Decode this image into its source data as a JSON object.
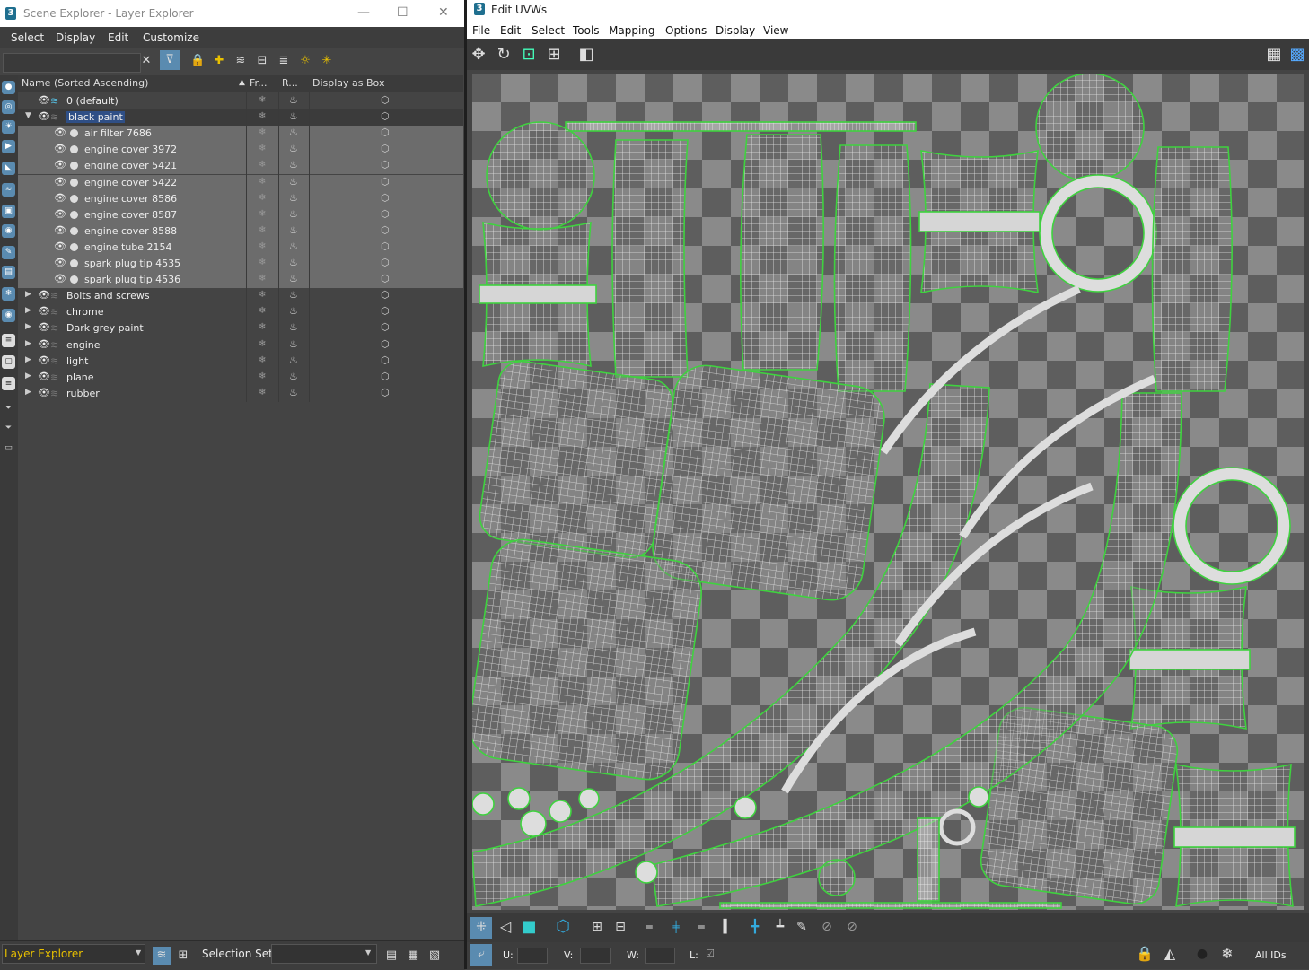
{
  "scene_explorer": {
    "title": "Scene Explorer - Layer Explorer",
    "app_icon": "3",
    "window_controls": [
      "—",
      "☐",
      "✕"
    ],
    "menu": [
      "Select",
      "Display",
      "Edit",
      "Customize"
    ],
    "search_placeholder": "",
    "columns": [
      "Name (Sorted Ascending)",
      "Fr...",
      "R...",
      "Display as Box"
    ],
    "rows": [
      {
        "name": "0 (default)",
        "level": 0,
        "kind": "layer-active",
        "expanded": null,
        "selected": false
      },
      {
        "name": "black paint",
        "level": 0,
        "kind": "layer",
        "expanded": true,
        "selected": true
      },
      {
        "name": "air filter 7686",
        "level": 1,
        "kind": "object",
        "selected": false
      },
      {
        "name": "engine cover 3972",
        "level": 1,
        "kind": "object",
        "selected": false
      },
      {
        "name": "engine cover 5421",
        "level": 1,
        "kind": "object",
        "selected": false
      },
      {
        "name": "engine cover 5422",
        "level": 1,
        "kind": "object",
        "selected": false
      },
      {
        "name": "engine cover 8586",
        "level": 1,
        "kind": "object",
        "selected": false
      },
      {
        "name": "engine cover 8587",
        "level": 1,
        "kind": "object",
        "selected": false
      },
      {
        "name": "engine cover 8588",
        "level": 1,
        "kind": "object",
        "selected": false
      },
      {
        "name": "engine tube 2154",
        "level": 1,
        "kind": "object",
        "selected": false
      },
      {
        "name": "spark plug tip 4535",
        "level": 1,
        "kind": "object",
        "selected": false
      },
      {
        "name": "spark plug tip 4536",
        "level": 1,
        "kind": "object",
        "selected": false
      },
      {
        "name": "Bolts and screws",
        "level": 0,
        "kind": "layer",
        "expanded": false,
        "selected": false
      },
      {
        "name": "chrome",
        "level": 0,
        "kind": "layer",
        "expanded": false,
        "selected": false
      },
      {
        "name": "Dark grey paint",
        "level": 0,
        "kind": "layer",
        "expanded": false,
        "selected": false
      },
      {
        "name": "engine",
        "level": 0,
        "kind": "layer",
        "expanded": false,
        "selected": false
      },
      {
        "name": "light",
        "level": 0,
        "kind": "layer",
        "expanded": false,
        "selected": false
      },
      {
        "name": "plane",
        "level": 0,
        "kind": "layer",
        "expanded": false,
        "selected": false
      },
      {
        "name": "rubber",
        "level": 0,
        "kind": "layer",
        "expanded": false,
        "selected": false
      }
    ],
    "bottom": {
      "explorer": "Layer Explorer",
      "selection_set_label": "Selection Set:"
    }
  },
  "uv_editor": {
    "title": "Edit UVWs",
    "app_icon": "3",
    "menu": [
      "File",
      "Edit",
      "Select",
      "Tools",
      "Mapping",
      "Options",
      "Display",
      "View"
    ],
    "status": {
      "u_label": "U:",
      "v_label": "V:",
      "w_label": "W:",
      "l_label": "L:",
      "ids": "All IDs"
    }
  },
  "colors": {
    "selection": "#2f4f86",
    "uv_edge": "#3fd23f",
    "checker_light": "#8a8a8a",
    "checker_dark": "#5e5e5e",
    "accent_yellow": "#e8c000"
  }
}
